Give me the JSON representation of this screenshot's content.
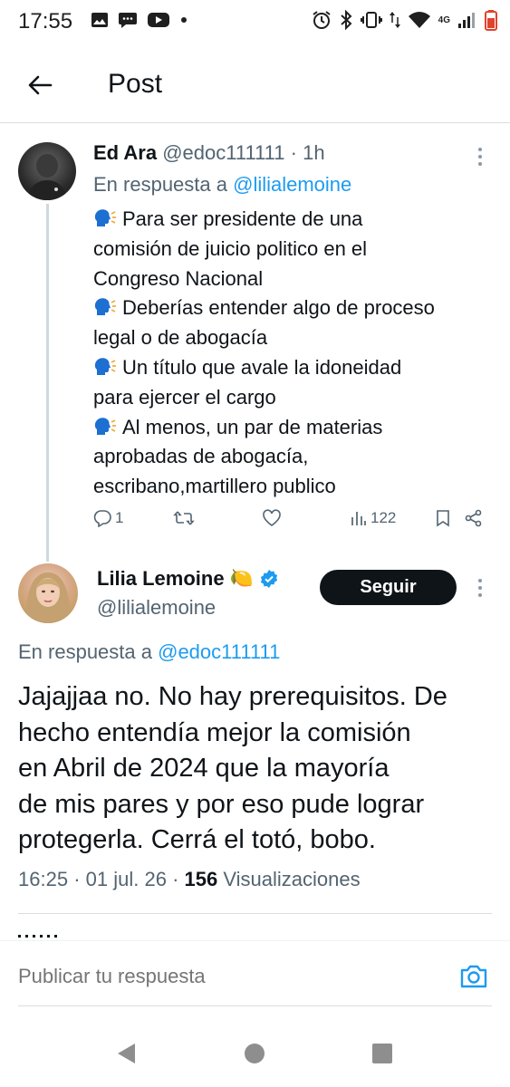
{
  "status_bar": {
    "time": "17:55",
    "network": "4G",
    "left_icons": [
      "image-icon",
      "chat-bubble-icon",
      "youtube-icon",
      "dot-icon"
    ],
    "right_icons": [
      "alarm-icon",
      "bluetooth-icon",
      "vibrate-icon",
      "data-arrows-icon",
      "wifi-icon",
      "signal-icon",
      "battery-icon"
    ],
    "battery_color": "#e0442e"
  },
  "header": {
    "title": "Post"
  },
  "reply_tweet": {
    "author_name": "Ed Ara",
    "handle": "@edoc111111",
    "separator": "·",
    "time": "1h",
    "reply_prefix": "En respuesta a",
    "reply_to": "@lilialemoine",
    "body_lines": [
      "Para ser presidente de una",
      "comisión de juicio politico en el",
      "Congreso Nacional",
      "Deberías entender algo de proceso",
      "legal o de abogacía",
      "Un título que avale la idoneidad",
      "para ejercer el cargo",
      "Al menos, un par de materias",
      "aprobadas de abogacía,",
      "escribano,martillero publico"
    ],
    "emoji_icon": "speaking-head-icon",
    "actions": {
      "replies": "1",
      "views": "122"
    }
  },
  "main_tweet": {
    "author_name": "Lilia Lemoine",
    "emoji": "🍋",
    "verified": true,
    "handle": "@lilialemoine",
    "follow_label": "Seguir",
    "reply_prefix": "En respuesta a",
    "reply_to": "@edoc111111",
    "body_lines": [
      "Jajajjaa no. No hay prerequisitos. De",
      "hecho entendía mejor la comisión",
      "en Abril de 2024 que la mayoría",
      "de mis pares y por eso pude lograr",
      "protegerla. Cerrá el totó, bobo."
    ],
    "time": "16:25",
    "date": "01 jul. 26",
    "separator": "·",
    "views_count": "156",
    "views_label": "Visualizaciones"
  },
  "compose": {
    "placeholder": "Publicar tu respuesta"
  },
  "colors": {
    "accent": "#1d9bf0",
    "text_primary": "#0f1419",
    "text_secondary": "#536471",
    "follow_bg": "#0f1419"
  }
}
